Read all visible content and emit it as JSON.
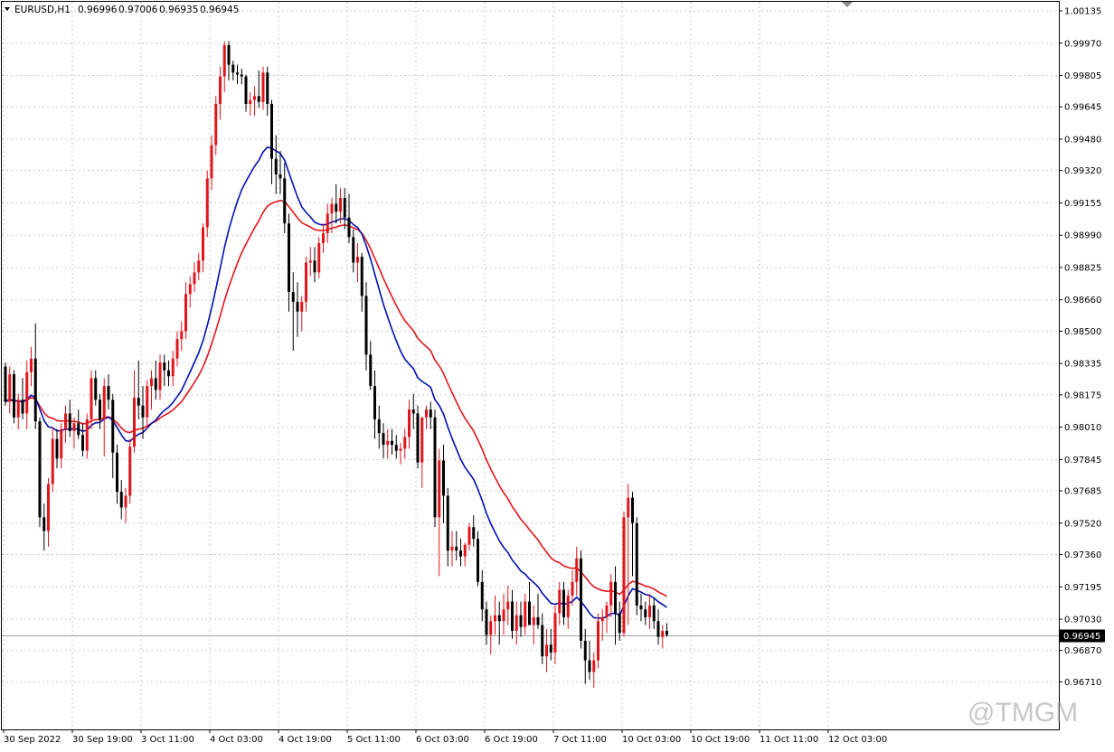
{
  "header": {
    "symbol": "EURUSD,H1",
    "o": "0.96996",
    "h": "0.97006",
    "l": "0.96935",
    "c": "0.96945"
  },
  "current_price_label": "0.96945",
  "watermark": "@TMGM",
  "colors": {
    "bull": "#e0161c",
    "bear": "#000000",
    "ma_fast": "#0010b0",
    "ma_slow": "#e0161c",
    "grid": "#c8c8c8",
    "price_line": "#a0a0a0"
  },
  "chart_data": {
    "type": "candlestick",
    "symbol": "EURUSD",
    "timeframe": "H1",
    "ylim": [
      0.96555,
      1.00135
    ],
    "y_ticks": [
      "1.00135",
      "0.99970",
      "0.99805",
      "0.99645",
      "0.99480",
      "0.99320",
      "0.99155",
      "0.98990",
      "0.98825",
      "0.98660",
      "0.98500",
      "0.98335",
      "0.98175",
      "0.98010",
      "0.97845",
      "0.97685",
      "0.97520",
      "0.97360",
      "0.97195",
      "0.97030",
      "0.96870",
      "0.96710"
    ],
    "x_ticks": [
      "30 Sep 2022",
      "30 Sep 19:00",
      "3 Oct 11:00",
      "4 Oct 03:00",
      "4 Oct 19:00",
      "5 Oct 11:00",
      "6 Oct 03:00",
      "6 Oct 19:00",
      "7 Oct 11:00",
      "10 Oct 03:00",
      "10 Oct 19:00",
      "11 Oct 11:00",
      "12 Oct 03:00"
    ],
    "grid": true,
    "bar_spacing_note": "one candle per hour, 4 bars per 16 hours between ticks",
    "candles": [
      [
        0.9832,
        0.9834,
        0.9812,
        0.9814
      ],
      [
        0.9814,
        0.9832,
        0.9808,
        0.9828
      ],
      [
        0.9828,
        0.983,
        0.9803,
        0.9806
      ],
      [
        0.9806,
        0.9818,
        0.98,
        0.9815
      ],
      [
        0.9815,
        0.9826,
        0.9805,
        0.9808
      ],
      [
        0.9808,
        0.9835,
        0.98,
        0.9829
      ],
      [
        0.9829,
        0.9842,
        0.9822,
        0.9836
      ],
      [
        0.9836,
        0.9854,
        0.98,
        0.9804
      ],
      [
        0.9804,
        0.9806,
        0.975,
        0.9755
      ],
      [
        0.9755,
        0.9762,
        0.9738,
        0.9748
      ],
      [
        0.9748,
        0.9775,
        0.974,
        0.9772
      ],
      [
        0.9772,
        0.9801,
        0.9768,
        0.9795
      ],
      [
        0.9795,
        0.98,
        0.978,
        0.9785
      ],
      [
        0.9785,
        0.9803,
        0.978,
        0.98
      ],
      [
        0.98,
        0.9812,
        0.9793,
        0.9808
      ],
      [
        0.9808,
        0.9815,
        0.9796,
        0.9799
      ],
      [
        0.9799,
        0.9806,
        0.979,
        0.9803
      ],
      [
        0.9803,
        0.981,
        0.9795,
        0.9797
      ],
      [
        0.9797,
        0.9803,
        0.9786,
        0.9789
      ],
      [
        0.9789,
        0.9808,
        0.9785,
        0.9805
      ],
      [
        0.9805,
        0.983,
        0.98,
        0.9826
      ],
      [
        0.9826,
        0.983,
        0.9812,
        0.9815
      ],
      [
        0.9815,
        0.9818,
        0.98,
        0.9805
      ],
      [
        0.9805,
        0.9826,
        0.9786,
        0.9822
      ],
      [
        0.9822,
        0.9828,
        0.981,
        0.9815
      ],
      [
        0.9815,
        0.9818,
        0.9775,
        0.9788
      ],
      [
        0.9788,
        0.9792,
        0.9762,
        0.9768
      ],
      [
        0.9768,
        0.9774,
        0.9754,
        0.976
      ],
      [
        0.976,
        0.977,
        0.9752,
        0.9766
      ],
      [
        0.9766,
        0.9795,
        0.9762,
        0.9791
      ],
      [
        0.9791,
        0.983,
        0.9788,
        0.9816
      ],
      [
        0.9816,
        0.9835,
        0.9805,
        0.9812
      ],
      [
        0.9812,
        0.9822,
        0.9795,
        0.9806
      ],
      [
        0.9806,
        0.9825,
        0.98,
        0.9822
      ],
      [
        0.9822,
        0.983,
        0.981,
        0.9826
      ],
      [
        0.9826,
        0.9835,
        0.9815,
        0.982
      ],
      [
        0.982,
        0.9838,
        0.9815,
        0.9834
      ],
      [
        0.9834,
        0.9838,
        0.9822,
        0.983
      ],
      [
        0.983,
        0.9835,
        0.9822,
        0.9827
      ],
      [
        0.9827,
        0.984,
        0.9822,
        0.9836
      ],
      [
        0.9836,
        0.985,
        0.9832,
        0.9846
      ],
      [
        0.9846,
        0.9855,
        0.984,
        0.985
      ],
      [
        0.985,
        0.9875,
        0.9846,
        0.9869
      ],
      [
        0.9869,
        0.9878,
        0.9862,
        0.9874
      ],
      [
        0.9874,
        0.9885,
        0.987,
        0.988
      ],
      [
        0.988,
        0.989,
        0.9876,
        0.9886
      ],
      [
        0.9886,
        0.9905,
        0.988,
        0.9903
      ],
      [
        0.9903,
        0.9932,
        0.9898,
        0.9928
      ],
      [
        0.9928,
        0.995,
        0.9922,
        0.9945
      ],
      [
        0.9945,
        0.997,
        0.994,
        0.9966
      ],
      [
        0.9966,
        0.9985,
        0.9958,
        0.998
      ],
      [
        0.998,
        0.9998,
        0.9972,
        0.9996
      ],
      [
        0.9996,
        0.9998,
        0.9978,
        0.9986
      ],
      [
        0.9986,
        0.9988,
        0.9978,
        0.9982
      ],
      [
        0.9982,
        0.9986,
        0.9976,
        0.9981
      ],
      [
        0.9981,
        0.9984,
        0.9976,
        0.998
      ],
      [
        0.998,
        0.9981,
        0.9962,
        0.9966
      ],
      [
        0.9966,
        0.9972,
        0.996,
        0.9968
      ],
      [
        0.9968,
        0.9975,
        0.996,
        0.997
      ],
      [
        0.997,
        0.9983,
        0.9964,
        0.9967
      ],
      [
        0.9967,
        0.9985,
        0.9963,
        0.9982
      ],
      [
        0.9982,
        0.9985,
        0.996,
        0.9966
      ],
      [
        0.9966,
        0.9968,
        0.9925,
        0.9938
      ],
      [
        0.9938,
        0.995,
        0.992,
        0.993
      ],
      [
        0.993,
        0.9942,
        0.992,
        0.9928
      ],
      [
        0.9928,
        0.9936,
        0.99,
        0.9905
      ],
      [
        0.9905,
        0.991,
        0.986,
        0.987
      ],
      [
        0.987,
        0.988,
        0.984,
        0.9865
      ],
      [
        0.9865,
        0.9875,
        0.9847,
        0.986
      ],
      [
        0.986,
        0.9868,
        0.985,
        0.9865
      ],
      [
        0.9865,
        0.9888,
        0.986,
        0.9885
      ],
      [
        0.9885,
        0.9893,
        0.9878,
        0.9886
      ],
      [
        0.9886,
        0.9893,
        0.9875,
        0.988
      ],
      [
        0.988,
        0.9898,
        0.9877,
        0.9895
      ],
      [
        0.9895,
        0.9905,
        0.989,
        0.99
      ],
      [
        0.99,
        0.9915,
        0.9895,
        0.991
      ],
      [
        0.991,
        0.9918,
        0.99,
        0.9915
      ],
      [
        0.9915,
        0.9925,
        0.9905,
        0.9911
      ],
      [
        0.9911,
        0.9923,
        0.9905,
        0.9918
      ],
      [
        0.9918,
        0.9923,
        0.9902,
        0.9908
      ],
      [
        0.9908,
        0.992,
        0.9895,
        0.9898
      ],
      [
        0.9898,
        0.9902,
        0.988,
        0.9885
      ],
      [
        0.9885,
        0.9895,
        0.9875,
        0.9888
      ],
      [
        0.9888,
        0.989,
        0.986,
        0.9868
      ],
      [
        0.9868,
        0.9875,
        0.983,
        0.9838
      ],
      [
        0.9838,
        0.9845,
        0.982,
        0.9822
      ],
      [
        0.9822,
        0.983,
        0.9795,
        0.9805
      ],
      [
        0.9805,
        0.9812,
        0.979,
        0.9798
      ],
      [
        0.9798,
        0.9803,
        0.9785,
        0.9792
      ],
      [
        0.9792,
        0.98,
        0.9785,
        0.9794
      ],
      [
        0.9794,
        0.98,
        0.9787,
        0.9792
      ],
      [
        0.9792,
        0.9797,
        0.9785,
        0.9789
      ],
      [
        0.9789,
        0.9793,
        0.9782,
        0.979
      ],
      [
        0.979,
        0.98,
        0.9785,
        0.9796
      ],
      [
        0.9796,
        0.9815,
        0.979,
        0.981
      ],
      [
        0.981,
        0.9818,
        0.98,
        0.9808
      ],
      [
        0.9808,
        0.9812,
        0.978,
        0.9783
      ],
      [
        0.9783,
        0.979,
        0.977,
        0.9806
      ],
      [
        0.9806,
        0.9812,
        0.98,
        0.981
      ],
      [
        0.981,
        0.9814,
        0.98,
        0.9806
      ],
      [
        0.9806,
        0.981,
        0.975,
        0.9755
      ],
      [
        0.9755,
        0.979,
        0.9725,
        0.9784
      ],
      [
        0.9784,
        0.9792,
        0.9752,
        0.9766
      ],
      [
        0.9766,
        0.977,
        0.973,
        0.9738
      ],
      [
        0.9738,
        0.9748,
        0.973,
        0.974
      ],
      [
        0.974,
        0.9748,
        0.9733,
        0.9738
      ],
      [
        0.9738,
        0.9744,
        0.973,
        0.9735
      ],
      [
        0.9735,
        0.9742,
        0.973,
        0.9741
      ],
      [
        0.9741,
        0.9752,
        0.9738,
        0.975
      ],
      [
        0.975,
        0.9756,
        0.974,
        0.9744
      ],
      [
        0.9744,
        0.9748,
        0.972,
        0.9722
      ],
      [
        0.9722,
        0.9728,
        0.9702,
        0.9708
      ],
      [
        0.9708,
        0.9712,
        0.969,
        0.9695
      ],
      [
        0.9695,
        0.9705,
        0.9685,
        0.9702
      ],
      [
        0.9702,
        0.9715,
        0.9695,
        0.9705
      ],
      [
        0.9705,
        0.9712,
        0.969,
        0.9702
      ],
      [
        0.9702,
        0.9716,
        0.9695,
        0.9708
      ],
      [
        0.9708,
        0.972,
        0.97,
        0.9712
      ],
      [
        0.9712,
        0.9718,
        0.9693,
        0.9697
      ],
      [
        0.9697,
        0.9712,
        0.969,
        0.9705
      ],
      [
        0.9705,
        0.9712,
        0.9694,
        0.9699
      ],
      [
        0.9699,
        0.9716,
        0.9695,
        0.9712
      ],
      [
        0.9712,
        0.9722,
        0.9704,
        0.97
      ],
      [
        0.97,
        0.971,
        0.969,
        0.9704
      ],
      [
        0.9704,
        0.9716,
        0.9698,
        0.97
      ],
      [
        0.97,
        0.9706,
        0.968,
        0.9684
      ],
      [
        0.9684,
        0.9698,
        0.9676,
        0.969
      ],
      [
        0.969,
        0.9698,
        0.9682,
        0.9686
      ],
      [
        0.9686,
        0.971,
        0.968,
        0.9706
      ],
      [
        0.9706,
        0.9722,
        0.97,
        0.9718
      ],
      [
        0.9718,
        0.9722,
        0.97,
        0.9704
      ],
      [
        0.9704,
        0.9718,
        0.9698,
        0.9715
      ],
      [
        0.9715,
        0.9728,
        0.971,
        0.9722
      ],
      [
        0.9722,
        0.974,
        0.9715,
        0.9734
      ],
      [
        0.9734,
        0.9738,
        0.9688,
        0.9692
      ],
      [
        0.9692,
        0.9698,
        0.967,
        0.9682
      ],
      [
        0.9682,
        0.9692,
        0.9672,
        0.9676
      ],
      [
        0.9676,
        0.9686,
        0.9668,
        0.9682
      ],
      [
        0.9682,
        0.9706,
        0.9678,
        0.9702
      ],
      [
        0.9702,
        0.9708,
        0.9692,
        0.9704
      ],
      [
        0.9704,
        0.9712,
        0.9696,
        0.971
      ],
      [
        0.971,
        0.9726,
        0.9704,
        0.9722
      ],
      [
        0.9722,
        0.973,
        0.969,
        0.9706
      ],
      [
        0.9706,
        0.9712,
        0.9692,
        0.9696
      ],
      [
        0.9696,
        0.9758,
        0.9694,
        0.9755
      ],
      [
        0.9755,
        0.9772,
        0.97,
        0.9765
      ],
      [
        0.9765,
        0.9768,
        0.9725,
        0.9752
      ],
      [
        0.9752,
        0.9755,
        0.9705,
        0.971
      ],
      [
        0.971,
        0.9716,
        0.9702,
        0.9708
      ],
      [
        0.9708,
        0.9712,
        0.97,
        0.9704
      ],
      [
        0.9704,
        0.9716,
        0.9698,
        0.971
      ],
      [
        0.971,
        0.9714,
        0.9698,
        0.9702
      ],
      [
        0.9702,
        0.9708,
        0.969,
        0.9694
      ],
      [
        0.9694,
        0.97,
        0.9688,
        0.9697
      ],
      [
        0.9697,
        0.9701,
        0.9694,
        0.9695
      ]
    ],
    "ma_fast": {
      "color": "#0010b0",
      "values_note": "faster moving average overlay (blue)"
    },
    "ma_slow": {
      "color": "#e0161c",
      "values_note": "slower moving average overlay (red)"
    }
  }
}
